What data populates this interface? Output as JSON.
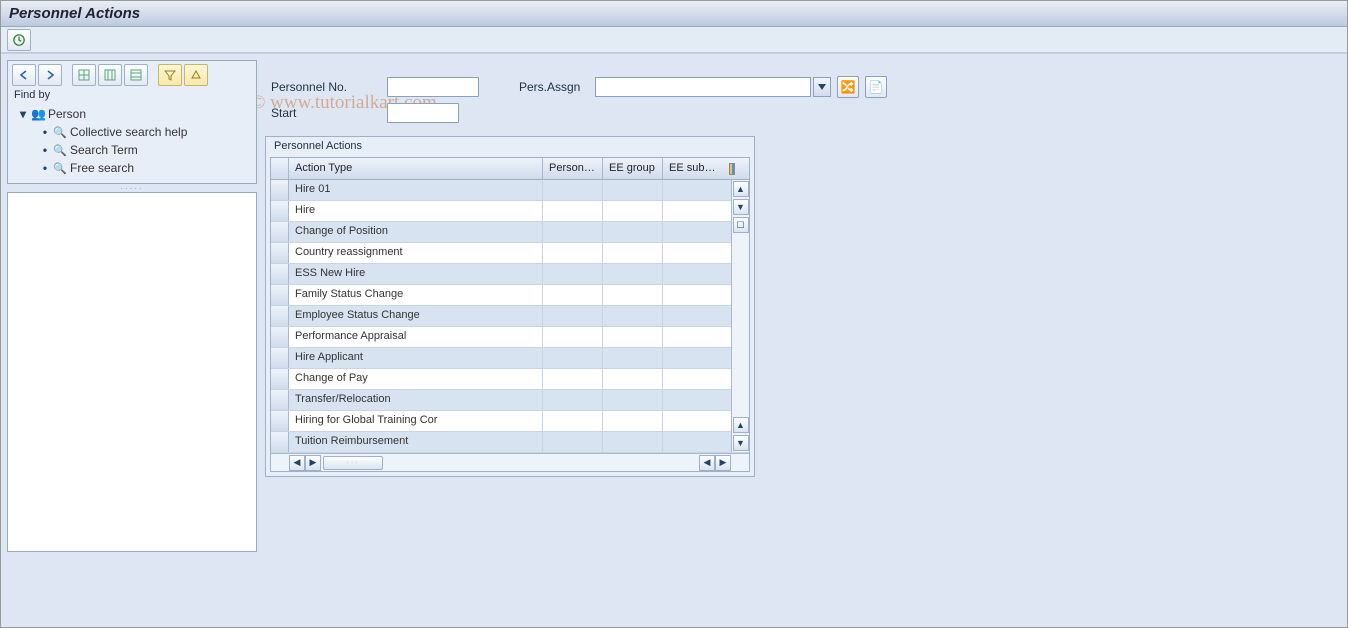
{
  "title": "Personnel Actions",
  "watermark": "© www.tutorialkart.com",
  "leftpane": {
    "findby_label": "Find by",
    "root_label": "Person",
    "children": [
      "Collective search help",
      "Search Term",
      "Free search"
    ]
  },
  "form": {
    "personnel_no_label": "Personnel No.",
    "start_label": "Start",
    "pers_assgn_label": "Pers.Assgn"
  },
  "grid": {
    "group_title": "Personnel Actions",
    "columns": {
      "action_type": "Action Type",
      "personn": "Personn...",
      "ee_group": "EE group",
      "ee_subg": "EE subg..."
    },
    "rows": [
      {
        "action_type": "Hire 01"
      },
      {
        "action_type": "Hire"
      },
      {
        "action_type": "Change of Position"
      },
      {
        "action_type": "Country reassignment"
      },
      {
        "action_type": "ESS New Hire"
      },
      {
        "action_type": "Family Status Change"
      },
      {
        "action_type": "Employee Status Change"
      },
      {
        "action_type": "Performance Appraisal"
      },
      {
        "action_type": "Hire Applicant"
      },
      {
        "action_type": "Change of Pay"
      },
      {
        "action_type": "Transfer/Relocation"
      },
      {
        "action_type": "Hiring for Global Training Cor"
      },
      {
        "action_type": "Tuition Reimbursement"
      }
    ]
  }
}
